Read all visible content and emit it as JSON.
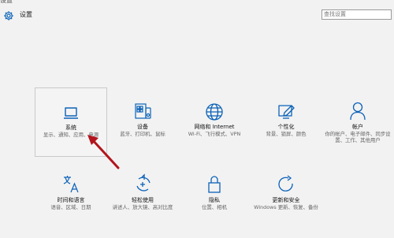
{
  "window": {
    "title": "设置"
  },
  "header": {
    "title": "设置"
  },
  "search": {
    "placeholder": "查找设置"
  },
  "tiles": [
    {
      "label": "系统",
      "description": "显示、通知、应用、电源",
      "icon": "laptop-icon"
    },
    {
      "label": "设备",
      "description": "蓝牙、打印机、鼠标",
      "icon": "devices-icon"
    },
    {
      "label": "网络和 Internet",
      "description": "Wi-Fi、飞行模式、VPN",
      "icon": "globe-icon"
    },
    {
      "label": "个性化",
      "description": "背景、锁屏、颜色",
      "icon": "pen-monitor-icon"
    },
    {
      "label": "帐户",
      "description": "你的帐户、电子邮件、同步设置、工作、其他用户",
      "icon": "user-icon"
    },
    {
      "label": "时间和语言",
      "description": "语音、区域、日期",
      "icon": "language-icon"
    },
    {
      "label": "轻松使用",
      "description": "讲述人、放大镜、高对比度",
      "icon": "ease-of-access-icon"
    },
    {
      "label": "隐私",
      "description": "位置、相机",
      "icon": "lock-icon"
    },
    {
      "label": "更新和安全",
      "description": "Windows 更新、恢复、备份",
      "icon": "refresh-icon"
    }
  ],
  "colors": {
    "accent": "#0b62b8",
    "background": "#f2f2f2",
    "arrow": "#b3141c"
  }
}
